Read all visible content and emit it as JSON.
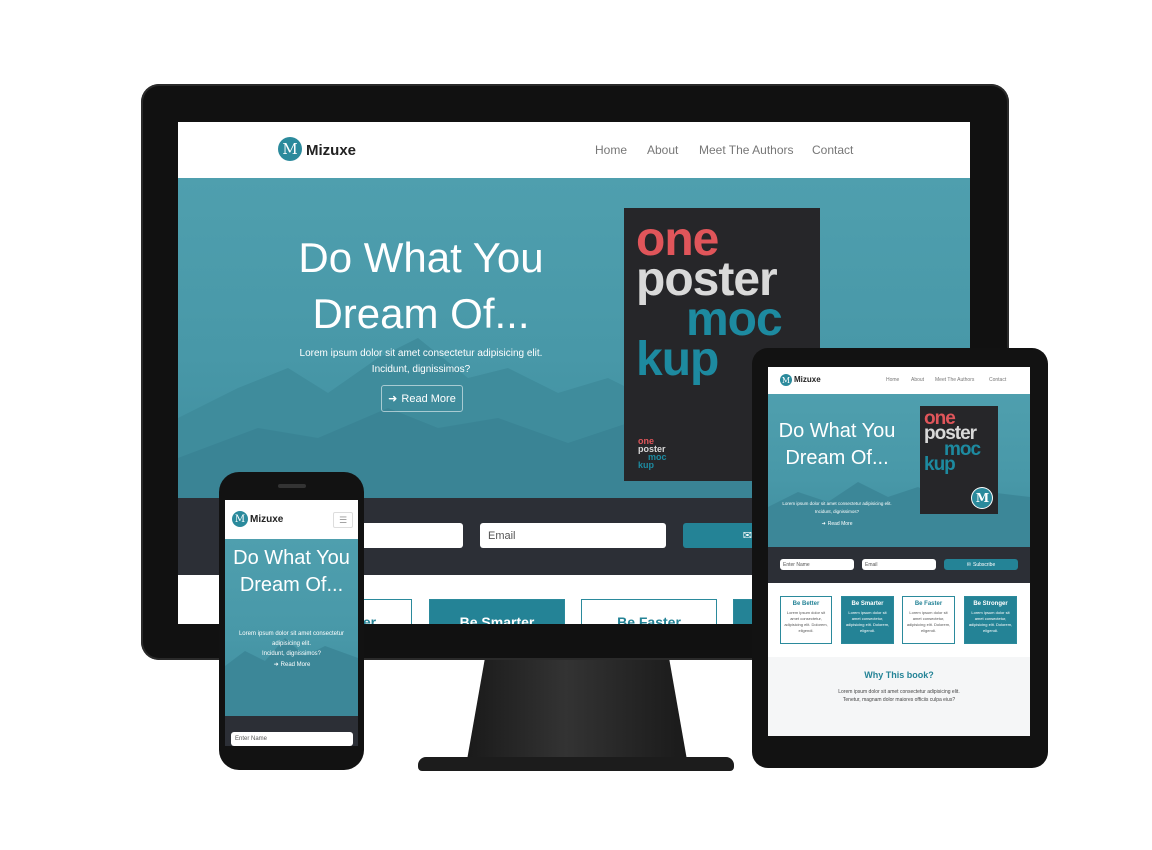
{
  "brand": {
    "name": "Mizuxe",
    "logo_letter": "M"
  },
  "nav": {
    "links": [
      "Home",
      "About",
      "Meet The Authors",
      "Contact"
    ]
  },
  "hero": {
    "title_line1": "Do What You",
    "title_line2": "Dream Of...",
    "subtitle_line1": "Lorem ipsum dolor sit amet consectetur adipisicing elit.",
    "subtitle_line2": "Incidunt, dignissimos?",
    "read_more_label": "Read More"
  },
  "poster": {
    "words": [
      "one",
      "poster",
      "moc",
      "kup"
    ],
    "colors": [
      "#e0555a",
      "#d9d9d9",
      "#1d8aa0",
      "#1d8aa0"
    ]
  },
  "subscribe": {
    "name_placeholder": "Enter Name",
    "email_placeholder": "Email",
    "button_label": "Subscribe"
  },
  "cards": [
    {
      "title": "Be Better",
      "text": "Lorem ipsum dolor sit amet consectetur, adipisicing elit. Dolorem, eligendi."
    },
    {
      "title": "Be Smarter",
      "text": "Lorem ipsum dolor sit amet consectetur, adipisicing elit. Dolorem, eligendi."
    },
    {
      "title": "Be Faster",
      "text": "Lorem ipsum dolor sit amet consectetur, adipisicing elit. Dolorem, eligendi."
    },
    {
      "title": "Be Stronger",
      "text": "Lorem ipsum dolor sit amet consectetur, adipisicing elit. Dolorem, eligendi."
    }
  ],
  "why": {
    "title": "Why This book?",
    "text_line1": "Lorem ipsum dolor sit amet consectetur adipisicing elit.",
    "text_line2": "Tenetur, magnam dolor maiores officiis culpa eius?"
  },
  "colors": {
    "accent": "#248396",
    "hero": "#4898a8",
    "dark_bar": "#2c2f36",
    "poster_bg": "#262629"
  },
  "icons": {
    "menu": "hamburger-icon",
    "arrow": "arrow-right-icon",
    "envelope": "envelope-icon"
  }
}
